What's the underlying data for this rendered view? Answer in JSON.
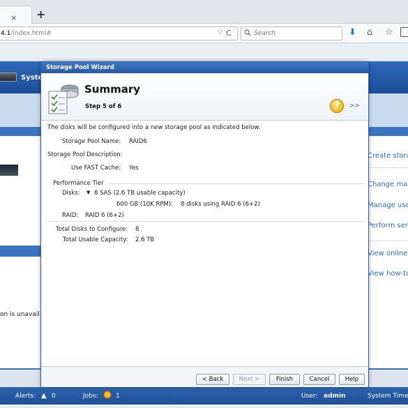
{
  "browser": {
    "tab_close": "×",
    "new_tab": "+",
    "url_bold": "4.1",
    "url_rest": "/index.html#",
    "url_drop_glyph": "▽",
    "url_reload_glyph": "C",
    "search_placeholder": "Search",
    "icons": [
      "search-icon",
      "download-icon",
      "home-icon",
      "star-icon",
      "bookmarks-icon"
    ]
  },
  "app": {
    "title": "Syste",
    "left_text": "on is unavail",
    "right_links": [
      "Create stora",
      "Change man",
      "Manage user",
      "Perform serv",
      "View online d",
      "View how-to"
    ]
  },
  "statusbar": {
    "alerts_label": "Alerts:",
    "alerts_count": "0",
    "jobs_label": "Jobs:",
    "jobs_count": "1",
    "user_label": "User:",
    "user_value": "admin",
    "system_time_label": "System Time:"
  },
  "wizard": {
    "title": "Storage Pool Wizard",
    "heading": "Summary",
    "step": "Step 5 of 6",
    "help_glyph": "?",
    "expand_glyph": ">>",
    "intro": "The disks will be configured into a new storage pool as indicated below.",
    "pool_name_label": "Storage Pool Name:",
    "pool_name_value": "RAID6",
    "pool_desc_label": "Storage Pool Description:",
    "pool_desc_value": "",
    "fast_cache_label": "Use FAST Cache:",
    "fast_cache_value": "Yes",
    "performance_tier": {
      "legend": "Performance Tier",
      "disks_label": "Disks:",
      "disks_summary": "8 SAS (2.6 TB usable capacity)",
      "disk_type": "600 GB (10K RPM):",
      "disk_detail": "8 disks using RAID 6 (6+2)",
      "raid_label": "RAID:",
      "raid_value": "RAID 6   (6+2)"
    },
    "total_disks_label": "Total Disks to Configure:",
    "total_disks_value": "8",
    "total_capacity_label": "Total Usable Capacity:",
    "total_capacity_value": "2.6 TB",
    "buttons": {
      "back": "< Back",
      "next": "Next >",
      "finish": "Finish",
      "cancel": "Cancel",
      "help": "Help"
    }
  },
  "colors": {
    "accent_blue": "#245aa6",
    "link_blue": "#2a6dc0",
    "help_orange": "#f0a800"
  }
}
